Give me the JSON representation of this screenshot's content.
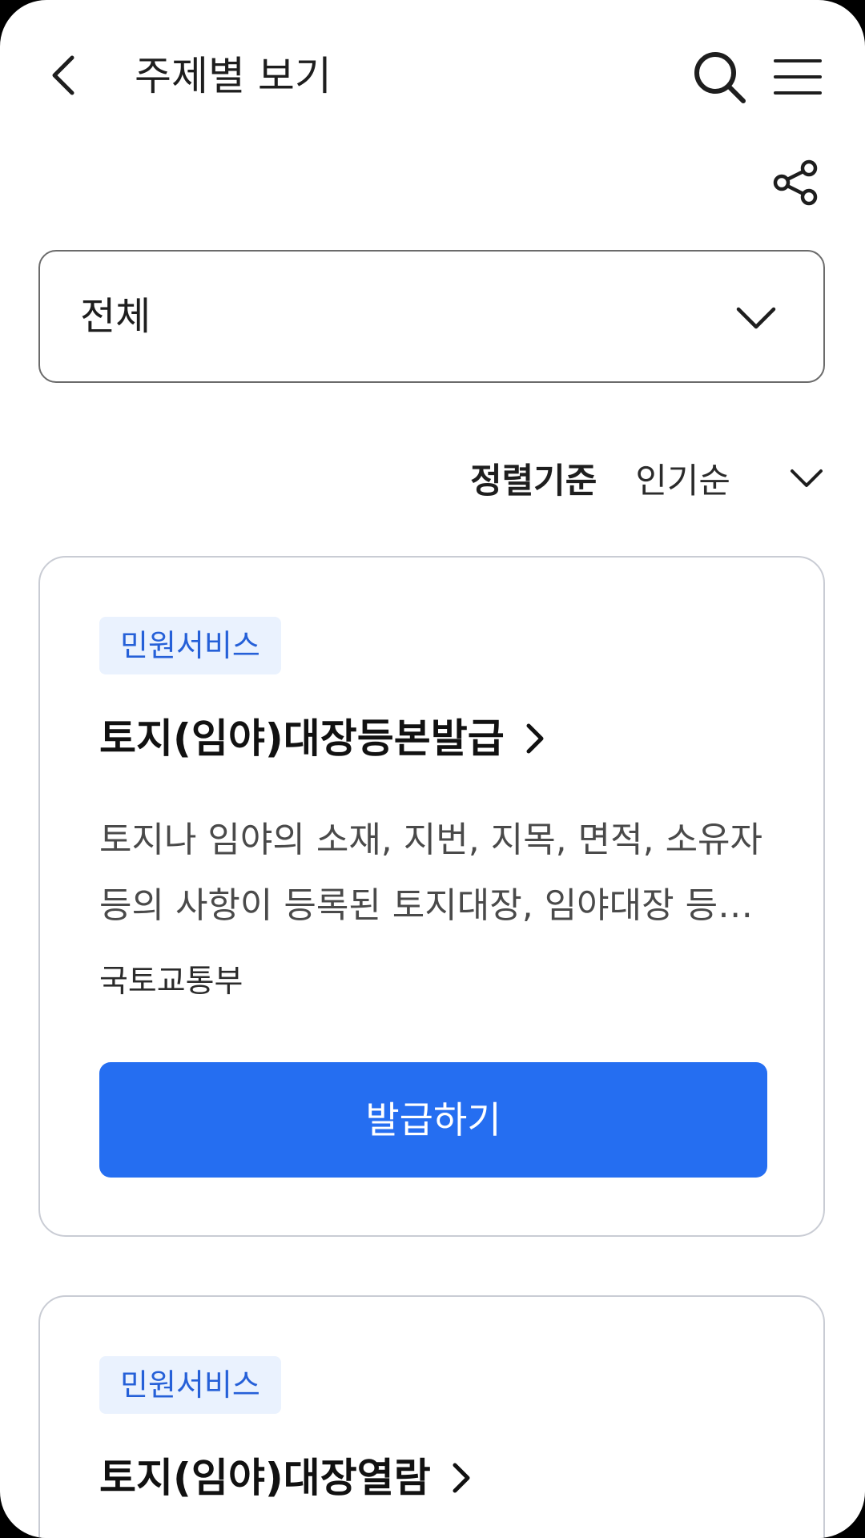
{
  "header": {
    "title": "주제별 보기"
  },
  "filter": {
    "category_value": "전체"
  },
  "sort": {
    "label": "정렬기준",
    "value": "인기순"
  },
  "cards": [
    {
      "badge": "민원서비스",
      "title": "토지(임야)대장등본발급",
      "description": "토지나 임야의 소재, 지번, 지목, 면적, 소유자 등의 사항이 등록된 토지대장, 임야대장 등본을 발급받을 수 있습니다.",
      "organization": "국토교통부",
      "button_label": "발급하기"
    },
    {
      "badge": "민원서비스",
      "title": "토지(임야)대장열람"
    }
  ],
  "icons": {
    "back": "chevron-left-icon",
    "search": "search-icon",
    "menu": "hamburger-menu-icon",
    "share": "share-icon",
    "dropdown": "chevron-down-icon",
    "title_arrow": "chevron-right-icon"
  },
  "colors": {
    "primary": "#256ef1",
    "badge_bg": "#eaf2fe",
    "badge_text": "#2560d8",
    "text_dark": "#1e1e1e",
    "border": "#c9ccd4"
  }
}
